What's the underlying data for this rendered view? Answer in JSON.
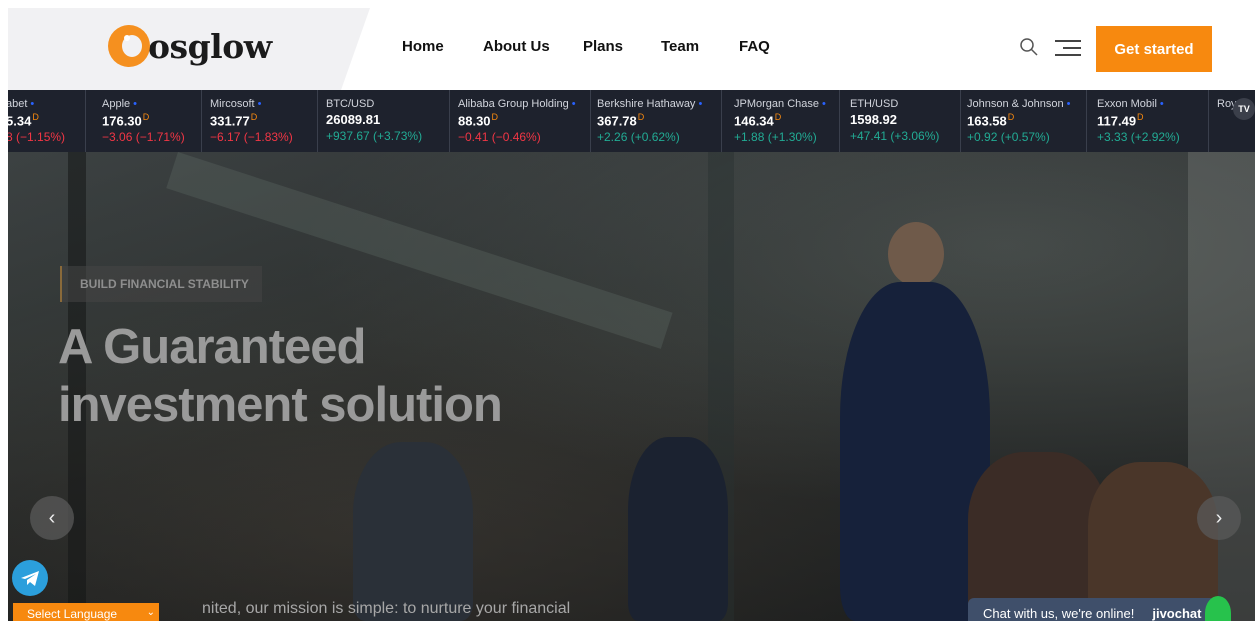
{
  "header": {
    "logo_text": "osglow",
    "nav": [
      "Home",
      "About Us",
      "Plans",
      "Team",
      "FAQ"
    ],
    "cta_label": "Get started"
  },
  "ticker": [
    {
      "name": "abet",
      "price": "5.34",
      "flag": "D",
      "change": "8 (−1.15%)",
      "direction": "down"
    },
    {
      "name": "Apple",
      "price": "176.30",
      "flag": "D",
      "change": "−3.06 (−1.71%)",
      "direction": "down"
    },
    {
      "name": "Mircosoft",
      "price": "331.77",
      "flag": "D",
      "change": "−6.17 (−1.83%)",
      "direction": "down"
    },
    {
      "name": "BTC/USD",
      "price": "26089.81",
      "flag": "",
      "change": "+937.67 (+3.73%)",
      "direction": "up"
    },
    {
      "name": "Alibaba Group Holding",
      "price": "88.30",
      "flag": "D",
      "change": "−0.41 (−0.46%)",
      "direction": "down"
    },
    {
      "name": "Berkshire Hathaway",
      "price": "367.78",
      "flag": "D",
      "change": "+2.26 (+0.62%)",
      "direction": "up"
    },
    {
      "name": "JPMorgan Chase",
      "price": "146.34",
      "flag": "D",
      "change": "+1.88 (+1.30%)",
      "direction": "up"
    },
    {
      "name": "ETH/USD",
      "price": "1598.92",
      "flag": "",
      "change": "+47.41 (+3.06%)",
      "direction": "up"
    },
    {
      "name": "Johnson & Johnson",
      "price": "163.58",
      "flag": "D",
      "change": "+0.92 (+0.57%)",
      "direction": "up"
    },
    {
      "name": "Exxon Mobil",
      "price": "117.49",
      "flag": "D",
      "change": "+3.33 (+2.92%)",
      "direction": "up"
    },
    {
      "name": "Roya",
      "price": "",
      "flag": "",
      "change": "",
      "direction": "up"
    }
  ],
  "hero": {
    "badge": "BUILD FINANCIAL STABILITY",
    "title_line1": "A Guaranteed",
    "title_line2": "investment solution",
    "subtitle": "nited, our mission is simple: to nurture your financial",
    "prev_arrow": "‹",
    "next_arrow": "›"
  },
  "widgets": {
    "language_label": "Select Language",
    "chat_label": "Chat with us, we're online!",
    "chat_brand": "jivochat"
  },
  "colors": {
    "accent": "#f7890f",
    "ticker_bg": "#1e222d",
    "up": "#22ab94",
    "down": "#f23645"
  }
}
